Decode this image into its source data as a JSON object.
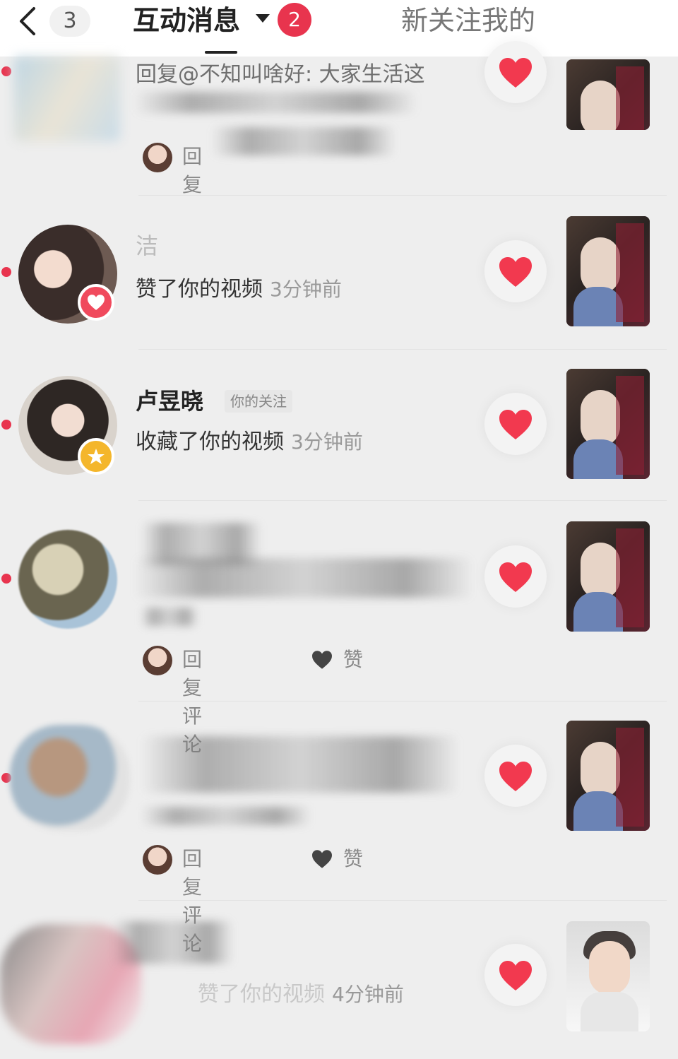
{
  "header": {
    "back_count": "3",
    "active_tab": "互动消息",
    "badge": "2",
    "other_tab": "新关注我的"
  },
  "rows": [
    {
      "preview_text": "回复@不知叫啥好: 大家生活这",
      "reply_label": "回复",
      "like_label": ""
    },
    {
      "name": "洁",
      "action": "赞了你的视频",
      "time": "3分钟前"
    },
    {
      "name": "卢昱晓",
      "tag": "你的关注",
      "action": "收藏了你的视频",
      "time": "3分钟前"
    },
    {
      "reply_label": "回复评论",
      "like_label": "赞"
    },
    {
      "reply_label": "回复评论",
      "like_label": "赞"
    },
    {
      "action": "赞了你的视频",
      "time": "4分钟前"
    }
  ],
  "colors": {
    "accent": "#e8344e",
    "star": "#f4b62b"
  }
}
